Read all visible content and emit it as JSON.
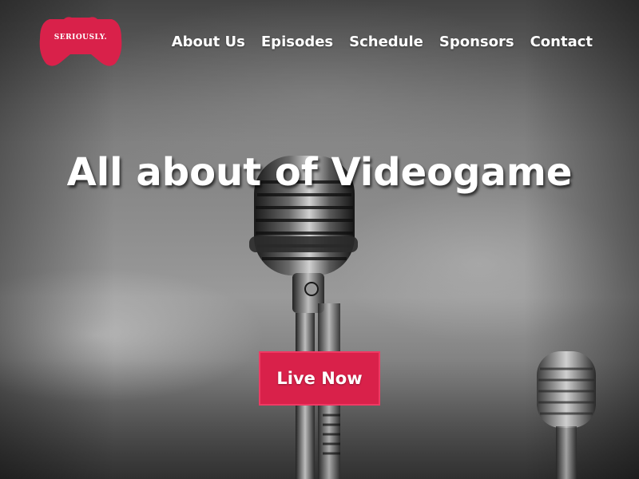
{
  "logo": {
    "text": "SERIOUSLY.",
    "shape": "gamepad",
    "color": "#d9214a"
  },
  "nav": {
    "items": [
      {
        "label": "About Us"
      },
      {
        "label": "Episodes"
      },
      {
        "label": "Schedule"
      },
      {
        "label": "Sponsors"
      },
      {
        "label": "Contact"
      }
    ]
  },
  "hero": {
    "title": "All about of Videogame",
    "background": "vintage-microphone-photo",
    "cta_label": "Live Now",
    "accent_color": "#d9214a"
  }
}
